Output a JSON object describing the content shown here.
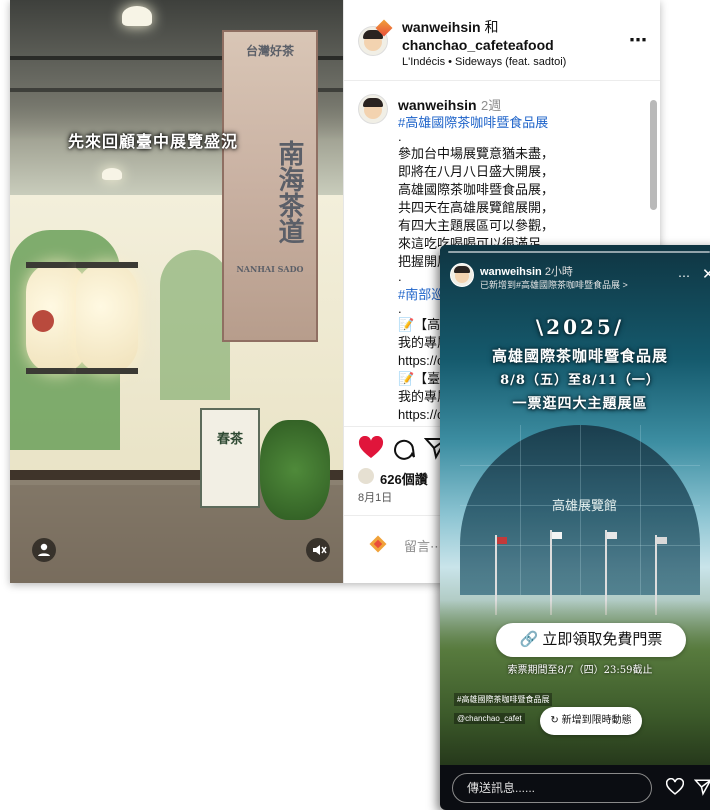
{
  "post": {
    "media": {
      "overlay_caption": "先來回顧臺中展覽盛況",
      "banner_top": "台灣好茶",
      "banner_main": "南海茶道",
      "banner_en": "NANHAI SADO",
      "sign_title": "春茶"
    },
    "header": {
      "user1": "wanweihsin",
      "and_word": "和",
      "user2": "chanchao_cafeteafood",
      "music": "L'Indécis • Sideways (feat. sadtoi)",
      "more_icon": "more-icon"
    },
    "caption": {
      "username": "wanweihsin",
      "time": "2週",
      "hashtag_main": "#高雄國際茶咖啡暨食品展",
      "dot1": ".",
      "lines": [
        "參加台中場展覽意猶未盡，",
        "即將在八月八日盛大開展，",
        "高雄國際茶咖啡暨食品展，",
        "共四天在高雄展覽館展開，",
        "有四大主題展區可以參觀，",
        "來這吃吃喝喝可以很滿足，",
        "把握開展"
      ],
      "dot2": ".",
      "hashtag_south": "#南部巡",
      "dot3": ".",
      "link_block": [
        "📝【高雄",
        "我的專屬",
        "https://c",
        "📝【臺南",
        "我的專屬",
        "https://c"
      ]
    },
    "actions": {
      "likes": "626個讚",
      "date": "8月1日",
      "comment_placeholder": "留言⋯⋯"
    }
  },
  "story": {
    "username": "wanweihsin",
    "time": "2小時",
    "subtitle": "已新增到#高雄國際茶咖啡暨食品展 >",
    "menu": "⋯",
    "close": "✕",
    "title_year": "\\2025/",
    "title_event": "高雄國際茶咖啡暨食品展",
    "title_dates": "8/8（五）至8/11（一）",
    "title_ticket": "一票逛四大主題展區",
    "building_sign": "高雄展覽館",
    "cta_label": "立即領取免費門票",
    "deadline": "索票期間至8/7（四）23:59截止",
    "tag1": "#高雄國際茶咖啡暨食品展",
    "tag2": "@chanchao_cafet",
    "add_story": "新增到限時動態",
    "message_placeholder": "傳送訊息......"
  }
}
